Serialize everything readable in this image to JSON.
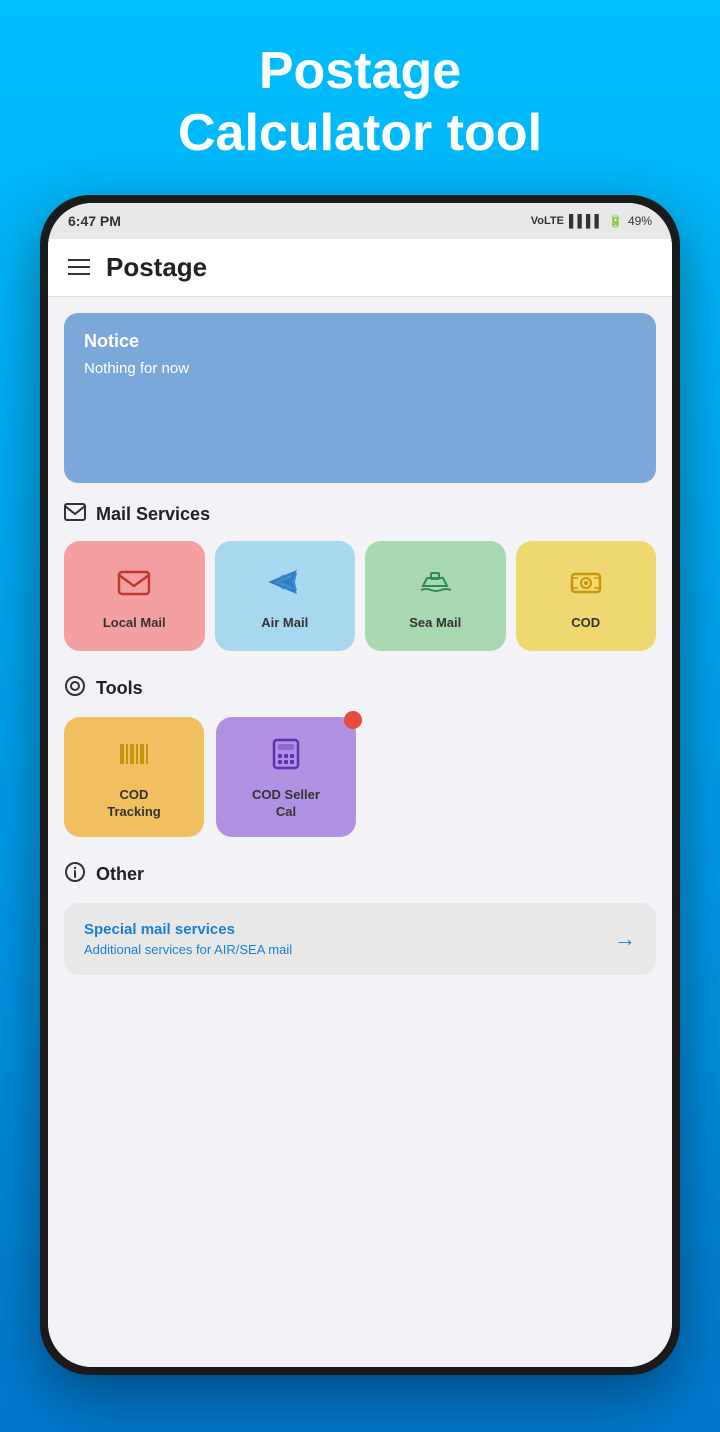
{
  "hero": {
    "title": "Postage\nCalculator tool"
  },
  "status_bar": {
    "time": "6:47 PM",
    "signal": "LTE",
    "battery": "49%"
  },
  "header": {
    "title": "Postage"
  },
  "notice": {
    "title": "Notice",
    "text": "Nothing for now"
  },
  "mail_services": {
    "section_title": "Mail Services",
    "items": [
      {
        "id": "local-mail",
        "label": "Local Mail",
        "color": "#f4a0a0",
        "icon_color": "#c0392b"
      },
      {
        "id": "air-mail",
        "label": "Air Mail",
        "color": "#a8d8f0",
        "icon_color": "#2b7ec4"
      },
      {
        "id": "sea-mail",
        "label": "Sea Mail",
        "color": "#a8d8b0",
        "icon_color": "#2e8b57"
      },
      {
        "id": "cod",
        "label": "COD",
        "color": "#f0d870",
        "icon_color": "#c8960c"
      }
    ]
  },
  "tools": {
    "section_title": "Tools",
    "items": [
      {
        "id": "cod-tracking",
        "label": "COD\nTracking",
        "color": "#f0c060",
        "icon_color": "#c8960c",
        "has_notification": false
      },
      {
        "id": "cod-seller-cal",
        "label": "COD Seller\nCal",
        "color": "#b090e0",
        "icon_color": "#6030b0",
        "has_notification": true
      }
    ]
  },
  "other": {
    "section_title": "Other",
    "card": {
      "title": "Special mail services",
      "subtitle": "Additional services for AIR/SEA mail"
    }
  }
}
